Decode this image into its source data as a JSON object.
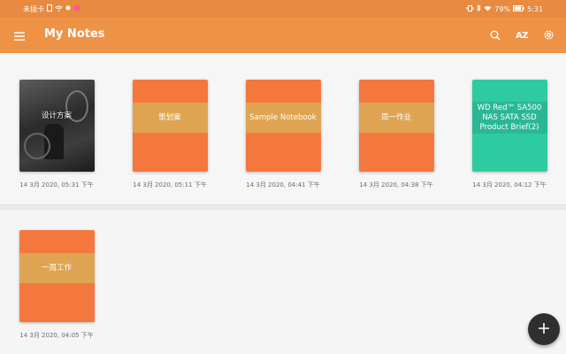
{
  "status_bar": {
    "carrier": "未插卡",
    "battery": "79%",
    "time": "5:31"
  },
  "app_bar": {
    "title": "My Notes",
    "sort_label": "AZ",
    "icons": [
      "menu-icon",
      "search-icon",
      "sort-az-icon",
      "settings-icon"
    ]
  },
  "notes": [
    {
      "title": "设计方案",
      "date": "14 3月 2020, 05:31 下午",
      "cover": "photo"
    },
    {
      "title": "策划案",
      "date": "14 3月 2020, 05:11 下午",
      "cover": "orange"
    },
    {
      "title": "Sample Notebook",
      "date": "14 3月 2020, 04:41 下午",
      "cover": "orange"
    },
    {
      "title": "周一作业",
      "date": "14 3月 2020, 04:38 下午",
      "cover": "orange"
    },
    {
      "title": "WD Red™ SA500 NAS SATA SSD Product Brief(2)",
      "date": "14 3月 2020, 04:12 下午",
      "cover": "teal"
    },
    {
      "title": "一周工作",
      "date": "14 3月 2020, 04:05 下午",
      "cover": "orange"
    }
  ],
  "fab": {
    "icon": "plus-icon"
  },
  "colors": {
    "status_bar": "#e88a3f",
    "app_bar": "#ee9246",
    "cover_orange": "#f4773e",
    "cover_band": "#dea452",
    "cover_teal": "#2ecba0",
    "fab": "#2f2f2f"
  }
}
